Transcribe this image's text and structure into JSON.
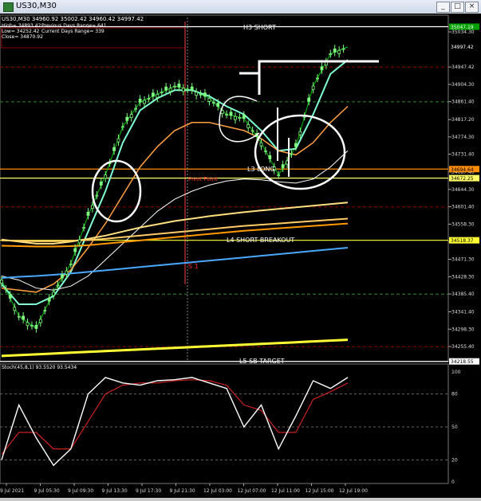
{
  "window": {
    "title": "US30,M30",
    "buttons": [
      "_",
      "□",
      "×"
    ]
  },
  "header": {
    "ohlc_line": "US30,M30  34960.92 35002.42 34960.42 34997.42",
    "stats": [
      [
        "High= 34893.42",
        "Previous Days Range= 641"
      ],
      [
        "Low= 34252.42",
        "Current Days Range= 339"
      ],
      [
        "Close= 34870.92",
        ""
      ]
    ]
  },
  "price_axis": {
    "ticks": [
      "35034.30",
      "34947.42",
      "34904.30",
      "34861.40",
      "34817.20",
      "34774.30",
      "34731.40",
      "34687.40",
      "34644.30",
      "34601.40",
      "34558.30",
      "34514.30",
      "34471.30",
      "34428.30",
      "34385.40",
      "34341.40",
      "34298.30",
      "34255.40"
    ],
    "tags": [
      {
        "label": "35047.19",
        "color": "#00a000",
        "text_color": "#ffffff"
      },
      {
        "label": "34997.42",
        "color": "#000000",
        "text_color": "#ffffff"
      },
      {
        "label": "34694.64",
        "color": "#ff8c00",
        "text_color": "#000000"
      },
      {
        "label": "34672.25",
        "color": "#ffff66",
        "text_color": "#000000"
      },
      {
        "label": "34518.37",
        "color": "#ffff33",
        "text_color": "#000000"
      },
      {
        "label": "34218.55",
        "color": "#ffffff",
        "text_color": "#000000"
      }
    ]
  },
  "annotations": {
    "h3": "H3 SHORT",
    "l3": "L3 LONG",
    "pivot": "Pivot Point",
    "l4": "L4 SHORT BREAKOUT",
    "s1": "S 1",
    "l5": "L5 SB TARGET"
  },
  "stoch": {
    "header": "Stoch(45,8,1) 93.5520 93.5434",
    "ticks": [
      "100",
      "80",
      "50",
      "20",
      "0"
    ]
  },
  "time_axis": [
    "9 Jul 2021",
    "9 Jul 05:30",
    "9 Jul 09:30",
    "9 Jul 13:30",
    "9 Jul 17:30",
    "9 Jul 21:30",
    "12 Jul 03:00",
    "12 Jul 07:00",
    "12 Jul 11:00",
    "12 Jul 15:00",
    "12 Jul 19:00"
  ],
  "chart_data": {
    "type": "line",
    "title": "US30,M30",
    "xlabel": "",
    "ylabel": "",
    "ylim": [
      34218,
      35060
    ],
    "x": [
      "9 Jul 01:30",
      "9 Jul 03:30",
      "9 Jul 05:30",
      "9 Jul 07:30",
      "9 Jul 09:30",
      "9 Jul 11:30",
      "9 Jul 13:30",
      "9 Jul 15:30",
      "9 Jul 17:30",
      "9 Jul 19:30",
      "9 Jul 21:30",
      "12 Jul 01:00",
      "12 Jul 03:00",
      "12 Jul 05:00",
      "12 Jul 07:00",
      "12 Jul 09:00",
      "12 Jul 11:00",
      "12 Jul 13:00",
      "12 Jul 15:00",
      "12 Jul 17:00",
      "12 Jul 19:00"
    ],
    "series": [
      {
        "values": [
          34420,
          34330,
          34300,
          34390,
          34460,
          34580,
          34680,
          34800,
          34860,
          34880,
          34900,
          34890,
          34870,
          34830,
          34820,
          34760,
          34680,
          34750,
          34900,
          34980,
          34997
        ]
      },
      {
        "values": [
          34410,
          34360,
          34360,
          34380,
          34440,
          34540,
          34640,
          34760,
          34840,
          34870,
          34890,
          34890,
          34875,
          34850,
          34830,
          34790,
          34740,
          34745,
          34830,
          34930,
          34965
        ]
      },
      {
        "values": [
          34400,
          34395,
          34390,
          34410,
          34445,
          34500,
          34560,
          34630,
          34700,
          34750,
          34790,
          34810,
          34810,
          34800,
          34790,
          34770,
          34740,
          34730,
          34760,
          34810,
          34850
        ]
      },
      {
        "values": [
          34430,
          34420,
          34400,
          34395,
          34405,
          34430,
          34470,
          34510,
          34550,
          34590,
          34620,
          34640,
          34655,
          34665,
          34670,
          34668,
          34663,
          34660,
          34670,
          34700,
          34740
        ]
      },
      {
        "values": [
          34520,
          34515,
          34510,
          34510,
          34515,
          34522,
          34530,
          34540,
          34550,
          34558,
          34566,
          34572,
          34578,
          34583,
          34588,
          34592,
          34596,
          34600,
          34604,
          34608,
          34612
        ]
      },
      {
        "values": [
          34518,
          34517,
          34516,
          34516,
          34517,
          34519,
          34522,
          34526,
          34530,
          34534,
          34538,
          34542,
          34546,
          34550,
          34554,
          34557,
          34560,
          34563,
          34566,
          34569,
          34572
        ]
      },
      {
        "values": [
          34505,
          34504,
          34503,
          34503,
          34504,
          34506,
          34510,
          34514,
          34518,
          34522,
          34526,
          34530,
          34534,
          34538,
          34542,
          34545,
          34548,
          34551,
          34554,
          34557,
          34560
        ]
      },
      {
        "values": [
          34425,
          34428,
          34430,
          34433,
          34436,
          34440,
          34444,
          34448,
          34452,
          34456,
          34460,
          34464,
          34468,
          34472,
          34476,
          34480,
          34484,
          34488,
          34492,
          34496,
          34500
        ]
      },
      {
        "values": [
          34232,
          34234,
          34236,
          34238,
          34240,
          34242,
          34244,
          34246,
          34248,
          34250,
          34252,
          34254,
          34256,
          34258,
          34260,
          34262,
          34264,
          34266,
          34268,
          34270,
          34272
        ]
      }
    ],
    "stochastic": {
      "ylim": [
        0,
        100
      ],
      "levels": [
        80,
        50,
        20
      ],
      "main": [
        20,
        70,
        40,
        15,
        30,
        80,
        95,
        90,
        88,
        92,
        93,
        95,
        90,
        85,
        50,
        70,
        30,
        60,
        92,
        85,
        95
      ],
      "signal": [
        25,
        45,
        45,
        30,
        30,
        55,
        80,
        88,
        90,
        90,
        92,
        93,
        92,
        88,
        70,
        65,
        45,
        45,
        75,
        82,
        90
      ]
    },
    "levels": [
      {
        "name": "H3",
        "value": 35047.19
      },
      {
        "name": "L3",
        "value": 34694.64
      },
      {
        "name": "Pivot",
        "value": 34672.25
      },
      {
        "name": "L4",
        "value": 34518.37
      },
      {
        "name": "L5",
        "value": 34218.55
      }
    ]
  }
}
